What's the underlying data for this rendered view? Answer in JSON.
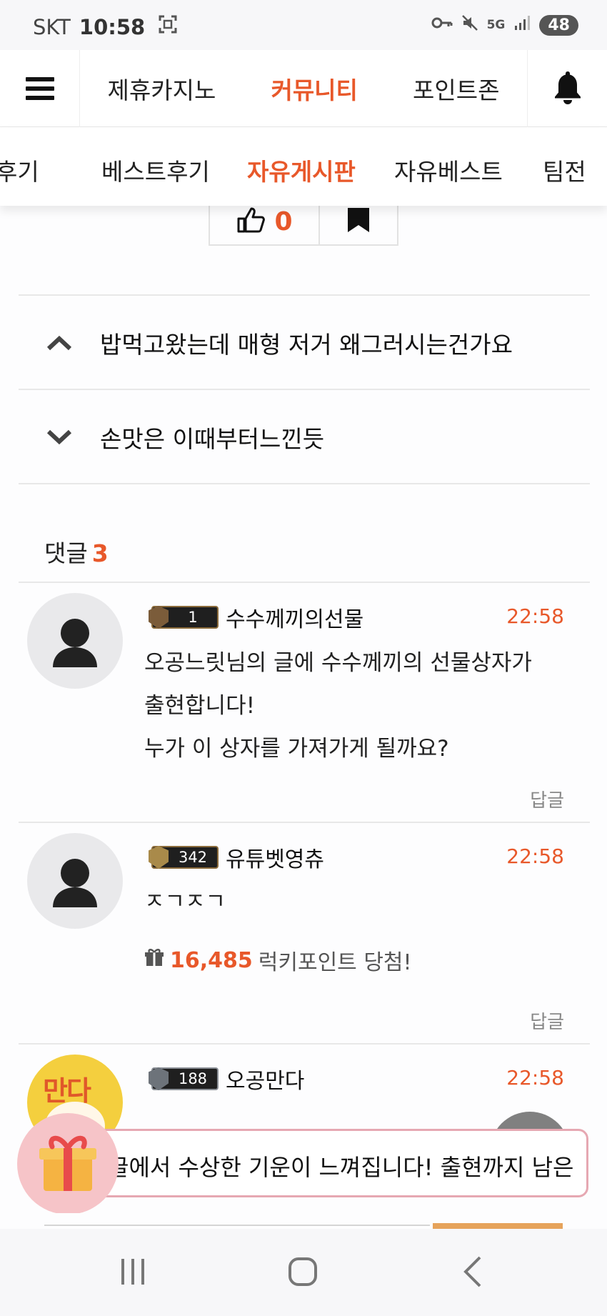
{
  "status_bar": {
    "carrier": "SKT",
    "time": "10:58",
    "network": "5G",
    "battery": "48"
  },
  "top_nav": {
    "items": [
      "제휴카지노",
      "커뮤니티",
      "포인트존"
    ],
    "active": "커뮤니티"
  },
  "sub_nav": {
    "items": [
      "후기",
      "베스트후기",
      "자유게시판",
      "자유베스트",
      "팀전"
    ],
    "active": "자유게시판"
  },
  "post": {
    "like_count": "0"
  },
  "adjacent_posts": {
    "prev_title": "밥먹고왔는데 매형 저거 왜그러시는건가요",
    "next_title": "손맛은 이때부터느낀듯"
  },
  "comments": {
    "label": "댓글",
    "count": "3",
    "reply_label": "답글",
    "items": [
      {
        "level": "1",
        "author": "수수께끼의선물",
        "time": "22:58",
        "lines": [
          "오공느릿님의 글에 수수께끼의 선물상자가",
          "출현합니다!",
          "누가 이 상자를 가져가게 될까요?"
        ]
      },
      {
        "level": "342",
        "author": "유튜벳영츄",
        "time": "22:58",
        "lines": [
          "ㅈㄱㅈㄱ"
        ],
        "lucky_points": "16,485",
        "lucky_text": "럭키포인트 당첨!"
      },
      {
        "level": "188",
        "author": "오공만다",
        "time": "22:58",
        "avatar_text": "만다"
      }
    ]
  },
  "toast": {
    "text": "글에서 수상한 기운이 느껴집니다! 출현까지 남은"
  },
  "colors": {
    "accent": "#e8582a",
    "toast_border": "#e6a8b2"
  }
}
